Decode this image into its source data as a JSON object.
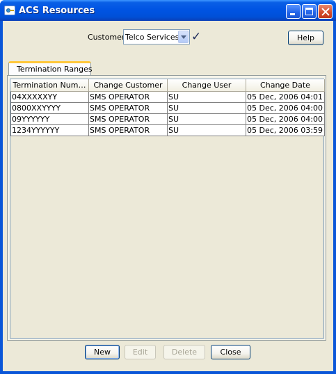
{
  "window": {
    "title": "ACS Resources",
    "accent_color": "#0054e3"
  },
  "customer": {
    "label": "Customer",
    "value": "Telco Services"
  },
  "help_button": {
    "label": "Help"
  },
  "tabs": [
    {
      "label": "Termination Ranges",
      "selected": true
    }
  ],
  "table": {
    "columns": [
      "Termination Num…",
      "Change Customer",
      "Change User",
      "Change Date"
    ],
    "rows": [
      [
        "04XXXXXYY",
        "SMS OPERATOR",
        "SU",
        "05 Dec, 2006 04:01"
      ],
      [
        "0800XXYYYY",
        "SMS OPERATOR",
        "SU",
        "05 Dec, 2006 04:00"
      ],
      [
        "09YYYYYY",
        "SMS OPERATOR",
        "SU",
        "05 Dec, 2006 04:00"
      ],
      [
        "1234YYYYYY",
        "SMS OPERATOR",
        "SU",
        "05 Dec, 2006 03:59"
      ]
    ]
  },
  "buttons": {
    "new": {
      "label": "New",
      "enabled": true
    },
    "edit": {
      "label": "Edit",
      "enabled": false
    },
    "delete": {
      "label": "Delete",
      "enabled": false
    },
    "close": {
      "label": "Close",
      "enabled": true
    }
  }
}
